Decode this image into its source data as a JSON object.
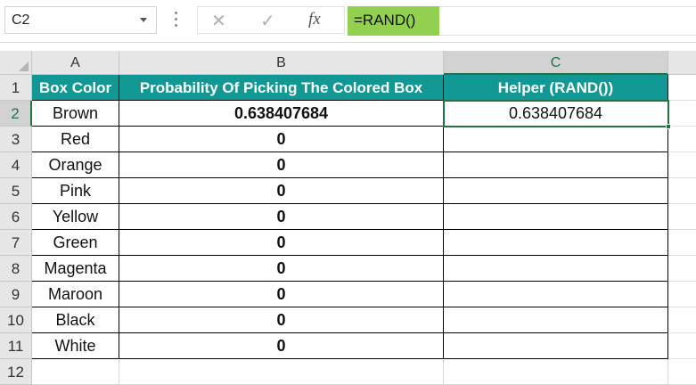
{
  "name_box": {
    "value": "C2"
  },
  "formula_bar": {
    "formula": "=RAND()",
    "cancel_glyph": "✕",
    "enter_glyph": "✓",
    "fx_glyph": "fx"
  },
  "accent_colors": {
    "header_fill": "#129894",
    "formula_highlight": "#92d050",
    "selection": "#217346"
  },
  "columns": [
    "A",
    "B",
    "C"
  ],
  "rows": [
    "1",
    "2",
    "3",
    "4",
    "5",
    "6",
    "7",
    "8",
    "9",
    "10",
    "11",
    "12"
  ],
  "headers": {
    "a": "Box Color",
    "b": "Probability Of Picking The Colored Box",
    "c": "Helper (RAND())"
  },
  "table": [
    {
      "color": "Brown",
      "probability": "0.638407684",
      "helper": "0.638407684"
    },
    {
      "color": "Red",
      "probability": "0",
      "helper": ""
    },
    {
      "color": "Orange",
      "probability": "0",
      "helper": ""
    },
    {
      "color": "Pink",
      "probability": "0",
      "helper": ""
    },
    {
      "color": "Yellow",
      "probability": "0",
      "helper": ""
    },
    {
      "color": "Green",
      "probability": "0",
      "helper": ""
    },
    {
      "color": "Magenta",
      "probability": "0",
      "helper": ""
    },
    {
      "color": "Maroon",
      "probability": "0",
      "helper": ""
    },
    {
      "color": "Black",
      "probability": "0",
      "helper": ""
    },
    {
      "color": "White",
      "probability": "0",
      "helper": ""
    }
  ]
}
